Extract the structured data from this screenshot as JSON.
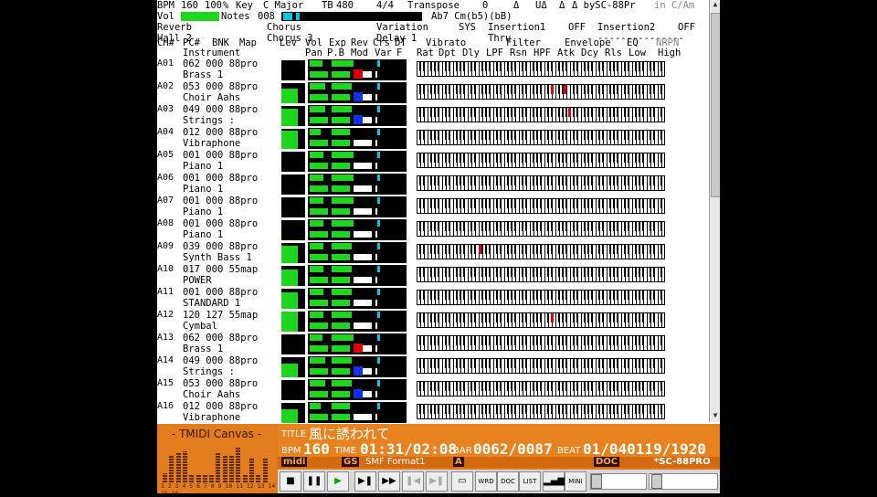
{
  "header": {
    "row1": {
      "bpm_label": "BPM",
      "bpm": "160",
      "percent": "100",
      "pct_sign": "%",
      "key_label": "Key",
      "key": "C  Major",
      "tb_label": "TB",
      "tb": "480",
      "meter": "4/4",
      "transpose_label": "Transpose",
      "transpose": "0",
      "delta": "Δ",
      "ud": "UΔ",
      "dd": "Δ",
      "by": "Δ  bySC-88Pr",
      "mode": "in C/Am"
    },
    "row2": {
      "vol_label": "Vol",
      "notes_label": "Notes",
      "notes": "008",
      "chord": "Ab7 Cm(b5)(bB)"
    },
    "row3": {
      "reverb_label": "Reverb",
      "chorus_label": "Chorus",
      "variation_label": "Variation",
      "sys_label": "SYS",
      "insertion1_label": "Insertion1",
      "ins1": "OFF",
      "insertion2_label": "Insertion2",
      "ins2": "OFF"
    },
    "row4": {
      "reverb": "Hall 2",
      "chorus": "Chorus 3",
      "variation": "Delay 1",
      "sys": "Thru",
      "ins2_line": "---------------"
    },
    "cols1": {
      "ch": "CH#",
      "pc": "PC#",
      "bnk": "BNK",
      "map": "Map",
      "lev": "Lev",
      "vol": "Vol",
      "exp": "Exp",
      "rev": "Rev",
      "crs": "Crs",
      "dt": "DT",
      "vibrato": "Vibrato",
      "filter": "Filter",
      "envelope": "Envelope",
      "eq": "EQ",
      "nrpn": "NRPN"
    },
    "cols2": {
      "instrument": "Instrument",
      "pan": "Pan",
      "pb": "P.B",
      "mod": "Mod",
      "var": "Var",
      "f": "F",
      "rat": "Rat",
      "dpt": "Dpt",
      "dly": "Dly",
      "lpf": "LPF",
      "rsn": "Rsn",
      "hpf": "HPF",
      "atk": "Atk",
      "dcy": "Dcy",
      "rls": "Rls",
      "low": "Low",
      "high": "High"
    }
  },
  "channels": [
    {
      "id": "A01",
      "pc": "062",
      "bnk": "000",
      "map": "88pro",
      "name": "Brass 1",
      "level": 0,
      "vol": 0.45,
      "exp": 0.6,
      "color_a": "#1fd61f",
      "red": true,
      "blue": false,
      "hits": []
    },
    {
      "id": "A02",
      "pc": "053",
      "bnk": "000",
      "map": "88pro",
      "name": "Choir Aahs",
      "level": 0.75,
      "vol": 0.55,
      "exp": 0.55,
      "red": false,
      "blue": true,
      "hits": [
        0.55,
        0.6
      ]
    },
    {
      "id": "A03",
      "pc": "049",
      "bnk": "000",
      "map": "88pro",
      "name": "Strings    :",
      "level": 0.85,
      "vol": 0.55,
      "exp": 0.55,
      "red": false,
      "blue": true,
      "hits": [
        0.62
      ]
    },
    {
      "id": "A04",
      "pc": "012",
      "bnk": "000",
      "map": "88pro",
      "name": "Vibraphone",
      "level": 0.9,
      "vol": 0.4,
      "exp": 0.5,
      "red": false,
      "blue": false,
      "hits": []
    },
    {
      "id": "A05",
      "pc": "001",
      "bnk": "000",
      "map": "88pro",
      "name": "Piano 1",
      "level": 0,
      "vol": 0.5,
      "exp": 0.6,
      "red": false,
      "blue": false,
      "hits": []
    },
    {
      "id": "A06",
      "pc": "001",
      "bnk": "000",
      "map": "88pro",
      "name": "Piano 1",
      "level": 0,
      "vol": 0.5,
      "exp": 0.6,
      "red": false,
      "blue": false,
      "hits": []
    },
    {
      "id": "A07",
      "pc": "001",
      "bnk": "000",
      "map": "88pro",
      "name": "Piano 1",
      "level": 0,
      "vol": 0.5,
      "exp": 0.6,
      "red": false,
      "blue": false,
      "hits": []
    },
    {
      "id": "A08",
      "pc": "001",
      "bnk": "000",
      "map": "88pro",
      "name": "Piano 1",
      "level": 0,
      "vol": 0.5,
      "exp": 0.6,
      "red": false,
      "blue": false,
      "hits": []
    },
    {
      "id": "A09",
      "pc": "039",
      "bnk": "000",
      "map": "88pro",
      "name": "Synth Bass 1",
      "level": 0.85,
      "vol": 0.5,
      "exp": 0.55,
      "red": false,
      "blue": false,
      "hits": [
        0.25
      ]
    },
    {
      "id": "A10",
      "pc": "017",
      "bnk": "000",
      "map": "55map",
      "name": "POWER",
      "level": 0.8,
      "vol": 0.5,
      "exp": 0.55,
      "red": false,
      "blue": false,
      "hits": []
    },
    {
      "id": "A11",
      "pc": "001",
      "bnk": "000",
      "map": "88pro",
      "name": "STANDARD 1",
      "level": 0.8,
      "vol": 0.5,
      "exp": 0.55,
      "red": false,
      "blue": false,
      "hits": []
    },
    {
      "id": "A12",
      "pc": "120",
      "bnk": "127",
      "map": "55map",
      "name": "Cymbal",
      "level": 1,
      "vol": 0.5,
      "exp": 0.55,
      "red": false,
      "blue": false,
      "hits": [
        0.55
      ]
    },
    {
      "id": "A13",
      "pc": "062",
      "bnk": "000",
      "map": "88pro",
      "name": "Brass 1",
      "level": 0,
      "vol": 0.45,
      "exp": 0.6,
      "red": true,
      "blue": false,
      "hits": []
    },
    {
      "id": "A14",
      "pc": "049",
      "bnk": "000",
      "map": "88pro",
      "name": "Strings    :",
      "level": 0.7,
      "vol": 0.55,
      "exp": 0.55,
      "red": false,
      "blue": true,
      "hits": []
    },
    {
      "id": "A15",
      "pc": "053",
      "bnk": "000",
      "map": "88pro",
      "name": "Choir Aahs",
      "level": 0,
      "vol": 0.55,
      "exp": 0.55,
      "red": false,
      "blue": true,
      "hits": []
    },
    {
      "id": "A16",
      "pc": "012",
      "bnk": "000",
      "map": "88pro",
      "name": "Vibraphone",
      "level": 0.7,
      "vol": 0.4,
      "exp": 0.5,
      "red": false,
      "blue": false,
      "hits": []
    }
  ],
  "canvas": {
    "title": "- TMIDI Canvas -",
    "nums": "1 2 3 4 5 6 7 8 9 10 11 12 13 14 15 16",
    "meters": [
      0.25,
      0.8,
      0.85,
      0.9,
      0.2,
      0.2,
      0.2,
      0.2,
      0.85,
      0.8,
      0.8,
      1,
      0.2,
      0.7,
      0.2,
      0.7
    ]
  },
  "info": {
    "title_label": "TITLE",
    "title": "風に誘われて",
    "bpm_label": "BPM",
    "bpm": "160",
    "time_label": "TIME",
    "time": "01:31/02:08",
    "bar_label": "BAR",
    "bar": "0062/0087",
    "beat_label": "BEAT",
    "beat": "01/040119/1920",
    "midi": "midi",
    "gs": "GS",
    "format": "SMF Format1",
    "a": "A",
    "doc": "DOC",
    "sc": "*SC-88PRO"
  },
  "controls": {
    "wrd": "WRD",
    "doc": "DOC",
    "list": "LIST",
    "mini": "MINI"
  },
  "colors": {
    "green": "#1fd61f",
    "red": "#e00000",
    "blue": "#1030f0",
    "cyan": "#00c8e8",
    "orange": "#e07a1b"
  }
}
